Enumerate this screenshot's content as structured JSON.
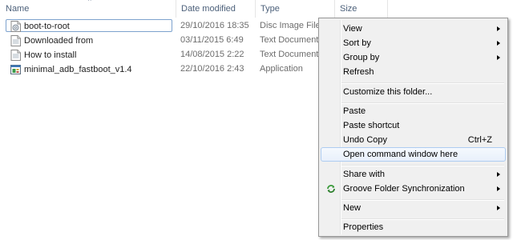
{
  "columns": {
    "name": "Name",
    "date": "Date modified",
    "type": "Type",
    "size": "Size"
  },
  "files": [
    {
      "name": "boot-to-root",
      "date": "29/10/2016 18:35",
      "type": "Disc Image File",
      "icon": "disc-image-file-icon"
    },
    {
      "name": "Downloaded from",
      "date": "03/11/2015 6:49",
      "type": "Text Document",
      "icon": "text-document-icon"
    },
    {
      "name": "How to install",
      "date": "14/08/2015 2:22",
      "type": "Text Document",
      "icon": "text-document-icon"
    },
    {
      "name": "minimal_adb_fastboot_v1.4",
      "date": "22/10/2016 2:43",
      "type": "Application",
      "icon": "application-icon"
    }
  ],
  "context_menu": {
    "view": "View",
    "sort_by": "Sort by",
    "group_by": "Group by",
    "refresh": "Refresh",
    "customize": "Customize this folder...",
    "paste": "Paste",
    "paste_shortcut": "Paste shortcut",
    "undo_copy": "Undo Copy",
    "undo_copy_shortcut": "Ctrl+Z",
    "open_command_window": "Open command window here",
    "share_with": "Share with",
    "groove_sync": "Groove Folder Synchronization",
    "new": "New",
    "properties": "Properties",
    "highlighted_item": "Open command window here"
  },
  "colors": {
    "header_text": "#4c607a",
    "selection_border": "#7da2ce",
    "menu_background": "#f0f0f0",
    "menu_highlight_border": "#aeccf1"
  }
}
